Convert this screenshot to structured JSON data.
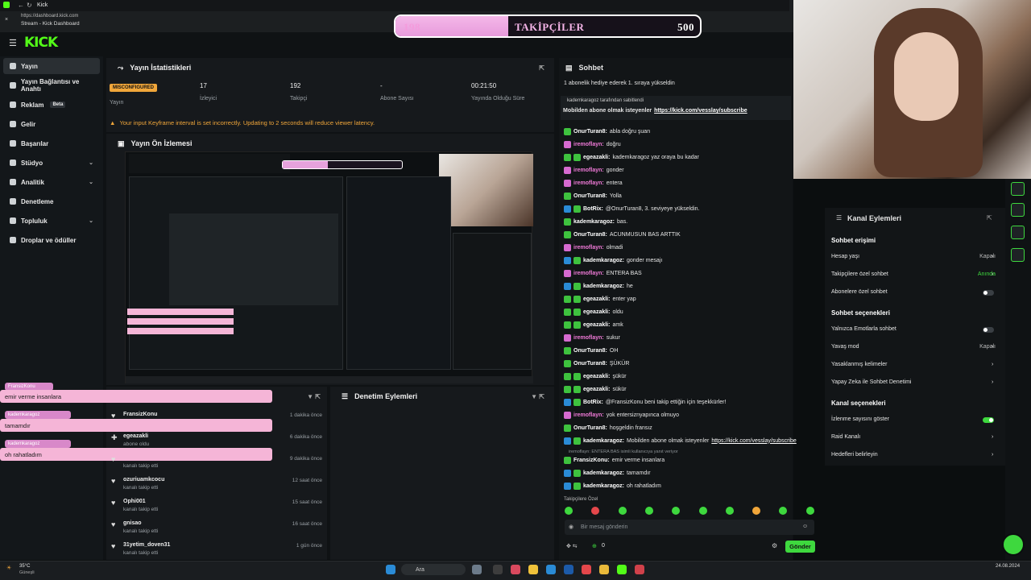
{
  "browser": {
    "tab_title": "Kick",
    "url": "https://dashboard.kick.com",
    "page_title": "Stream - Kick Dashboard"
  },
  "follow_bar": {
    "current": "198",
    "label": "TAKİPÇİLER",
    "goal": "500",
    "fill_fraction": 0.37
  },
  "sidebar": {
    "logo": "KICK",
    "items": [
      {
        "label": "Yayın",
        "active": true
      },
      {
        "label": "Yayın Bağlantısı ve Anahtı"
      },
      {
        "label": "Reklam",
        "badge": "Beta"
      },
      {
        "label": "Gelir"
      },
      {
        "label": "Başarılar"
      },
      {
        "label": "Stüdyo",
        "chevron": true
      },
      {
        "label": "Analitik",
        "chevron": true
      },
      {
        "label": "Denetleme"
      },
      {
        "label": "Topluluk",
        "chevron": true
      },
      {
        "label": "Droplar ve ödüller"
      }
    ]
  },
  "stats": {
    "title": "Yayın İstatistikleri",
    "status_badge": "MISCONFIGURED",
    "status_label": "Yayın",
    "items": [
      {
        "value": "17",
        "label": "İzleyici"
      },
      {
        "value": "192",
        "label": "Takipçi"
      },
      {
        "value": "-",
        "label": "Abone Sayısı"
      },
      {
        "value": "00:21:50",
        "label": "Yayında Olduğu Süre"
      }
    ],
    "warning": "Your input Keyframe interval is set incorrectly. Updating to 2 seconds will reduce viewer latency."
  },
  "preview": {
    "title": "Yayın Ön İzlemesi"
  },
  "overlay_chat": [
    {
      "user": "FransizKonu",
      "text": "emir verme insanlara"
    },
    {
      "user": "kademkaragoz",
      "text": "tamamdır"
    },
    {
      "user": "kademkaragoz",
      "text": "oh rahatladım"
    }
  ],
  "followers": [
    {
      "name": "FransizKonu",
      "sub": "",
      "time": "1 dakika önce"
    },
    {
      "name": "egeazakli",
      "sub": "abone oldu",
      "time": "6 dakika önce"
    },
    {
      "name": "",
      "sub": "kanalı takip etti",
      "time": "9 dakika önce"
    },
    {
      "name": "ozuriuamkcocu",
      "sub": "kanalı takip etti",
      "time": "12 saat önce"
    },
    {
      "name": "Ophi001",
      "sub": "kanalı takip etti",
      "time": "15 saat önce"
    },
    {
      "name": "gnisao",
      "sub": "kanalı takip etti",
      "time": "16 saat önce"
    },
    {
      "name": "31yetim_doven31",
      "sub": "kanalı takip etti",
      "time": "1 gün önce"
    }
  ],
  "moderation": {
    "title": "Denetim Eylemleri"
  },
  "chat": {
    "title": "Sohbet",
    "pinned_top": "1 abonelik hediye ederek 1. sıraya yükseldin",
    "pinned_by": "kademkaragoz tarafından sabitlendi",
    "pinned_msg": "Mobilden abone olmak isteyenler",
    "pinned_link": "https://kick.com/vesslay/subscribe",
    "messages": [
      {
        "user": "OnurTuran8:",
        "text": "abla doğru şuan",
        "b": [
          "g"
        ]
      },
      {
        "user": "iremoflayn:",
        "text": "doğru",
        "b": [
          "p"
        ]
      },
      {
        "user": "egeazakli:",
        "text": "kademkaragoz yaz oraya bu kadar",
        "b": [
          "g",
          "g"
        ]
      },
      {
        "user": "iremoflayn:",
        "text": "gonder",
        "b": [
          "p"
        ]
      },
      {
        "user": "iremoflayn:",
        "text": "entera",
        "b": [
          "p"
        ]
      },
      {
        "user": "OnurTuran8:",
        "text": "Yolla",
        "b": [
          "g"
        ]
      },
      {
        "user": "BotRix:",
        "text": "@OnurTuran8, 3. seviyeye yükseldin.",
        "b": [
          "b",
          "g"
        ]
      },
      {
        "user": "kademkaragoz:",
        "text": "bas.",
        "b": [
          "g"
        ]
      },
      {
        "user": "OnurTuran8:",
        "text": "ACUNMUSUN BAS ARTTIK",
        "b": [
          "g"
        ]
      },
      {
        "user": "iremoflayn:",
        "text": "olmadi",
        "b": [
          "p"
        ]
      },
      {
        "user": "kademkaragoz:",
        "text": "gonder mesajı",
        "b": [
          "b",
          "g"
        ]
      },
      {
        "user": "iremoflayn:",
        "text": "ENTERA BAS",
        "b": [
          "p"
        ]
      },
      {
        "user": "kademkaragoz:",
        "text": "he",
        "b": [
          "b",
          "g"
        ]
      },
      {
        "user": "egeazakli:",
        "text": "enter yap",
        "b": [
          "g",
          "g"
        ]
      },
      {
        "user": "egeazakli:",
        "text": "oldu",
        "b": [
          "g",
          "g"
        ]
      },
      {
        "user": "egeazakli:",
        "text": "amk",
        "b": [
          "g",
          "g"
        ]
      },
      {
        "user": "iremoflayn:",
        "text": "sukur",
        "b": [
          "p"
        ]
      },
      {
        "user": "OnurTuran8:",
        "text": "OH",
        "b": [
          "g"
        ]
      },
      {
        "user": "OnurTuran8:",
        "text": "ŞÜKÜR",
        "b": [
          "g"
        ]
      },
      {
        "user": "egeazakli:",
        "text": "şükür",
        "b": [
          "g",
          "g"
        ]
      },
      {
        "user": "egeazakli:",
        "text": "sükür",
        "b": [
          "g",
          "g"
        ]
      },
      {
        "user": "BotRix:",
        "text": "@FransizKonu beni takip ettiğin için teşekkürler!",
        "b": [
          "b",
          "g"
        ]
      },
      {
        "user": "iremoflayn:",
        "text": "yok entersiznyapınca olmuyo",
        "b": [
          "p"
        ]
      },
      {
        "user": "OnurTuran8:",
        "text": "hoşgeldin fransız",
        "b": [
          "g"
        ]
      },
      {
        "user": "kademkaragoz:",
        "text": "Mobilden abone olmak isteyenler",
        "link": "https://kick.com/vesslay/subscribe",
        "b": [
          "b",
          "g"
        ]
      }
    ],
    "reply_note": "iremoflayn: ENTERA BAS isimli kullanıcıya yanıt veriyor",
    "tail": [
      {
        "user": "FransizKonu:",
        "text": "emir verme insanlara",
        "b": [
          "g"
        ]
      },
      {
        "user": "kademkaragoz:",
        "text": "tamamdır",
        "b": [
          "b",
          "g"
        ]
      },
      {
        "user": "kademkaragoz:",
        "text": "oh rahatladım",
        "b": [
          "b",
          "g"
        ]
      }
    ],
    "followers_only": "Takipçilere Özel",
    "input_placeholder": "Bir mesaj gönderin",
    "counter": "0",
    "send": "Gönder"
  },
  "channel_actions": {
    "title": "Kanal Eylemleri",
    "sections": [
      {
        "heading": "Sohbet erişimi",
        "rows": [
          {
            "label": "Hesap yaşı",
            "value": "Kapalı"
          },
          {
            "label": "Takipçilere özel sohbet",
            "value": "Anında"
          },
          {
            "label": "Abonelere özel sohbet",
            "toggle": "off"
          }
        ]
      },
      {
        "heading": "Sohbet seçenekleri",
        "rows": [
          {
            "label": "Yalnızca Emotlarla sohbet",
            "toggle": "off"
          },
          {
            "label": "Yavaş mod",
            "value": "Kapalı"
          },
          {
            "label": "Yasaklanmış kelimeler"
          },
          {
            "label": "Yapay Zeka ile Sohbet Denetimi"
          }
        ]
      },
      {
        "heading": "Kanal seçenekleri",
        "rows": [
          {
            "label": "İzlenme sayısını göster",
            "toggle": "on"
          },
          {
            "label": "Raid Kanalı"
          },
          {
            "label": "Hedefleri belirleyin"
          }
        ]
      }
    ]
  },
  "taskbar": {
    "weather": "35°C",
    "weather_sub": "Güneşli",
    "search": "Ara",
    "time": "",
    "date": "24.08.2024"
  },
  "colors": {
    "accent": "#53fc18",
    "pink": "#f5b5d7",
    "warn": "#f0a63a"
  }
}
